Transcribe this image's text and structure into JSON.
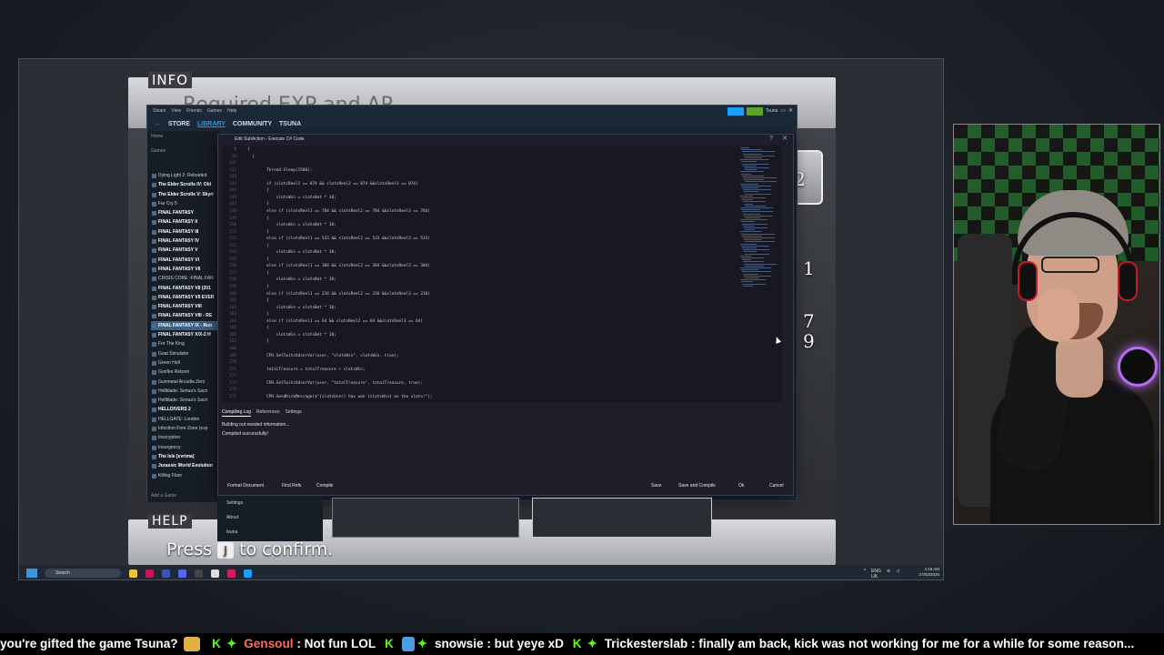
{
  "game": {
    "info_label": "INFO",
    "info_text": "Required EXP and AP",
    "help_label": "HELP",
    "help_prefix": "Press",
    "help_key": "J",
    "help_suffix": "to confirm.",
    "side_numbers": [
      "2",
      "1",
      "7",
      "9"
    ]
  },
  "steam": {
    "menu": [
      "Steam",
      "View",
      "Friends",
      "Games",
      "Help"
    ],
    "nav": [
      "STORE",
      "LIBRARY",
      "COMMUNITY",
      "TSUNA"
    ],
    "active_nav": "LIBRARY",
    "home": "Home",
    "games_label": "Games",
    "games": [
      "Dying Light 2: Reloaded",
      "The Elder Scrolls IV: Obl",
      "The Elder Scrolls V: Skyri",
      "Far Cry 5",
      "FINAL FANTASY",
      "FINAL FANTASY II",
      "FINAL FANTASY III",
      "FINAL FANTASY IV",
      "FINAL FANTASY V",
      "FINAL FANTASY VI",
      "FINAL FANTASY VII",
      "CRISIS CORE -FINAL FAN",
      "FINAL FANTASY VII (201",
      "FINAL FANTASY VII EVER",
      "FINAL FANTASY VIII",
      "FINAL FANTASY VIII - RE",
      "FINAL FANTASY IX - Run",
      "FINAL FANTASY X/X-2 H",
      "For The King",
      "Goat Simulator",
      "Green Hell",
      "Gunfire Reborn",
      "Gunmetal Arcadia Zero",
      "Hellblade: Senua's Sacri",
      "Hellblade: Senua's Sacri",
      "HELLDIVERS 2",
      "HELLGATE: London",
      "Infection Free Zone (exp",
      "Inscryption",
      "Insurgency",
      "The Isle [evrima]",
      "Jurassic World Evolution",
      "Killing Floor"
    ],
    "selected_game": "FINAL FANTASY IX - Run",
    "add_game": "Add a Game",
    "user": "Tsuna",
    "bottom_menu": [
      "Settings",
      "About",
      "tsuna"
    ]
  },
  "dialog": {
    "title": "Edit SubAction - Execute C# Code",
    "help_glyph": "?",
    "close_glyph": "✕",
    "code_lines": [
      {
        "n": "8",
        "t": "{"
      },
      {
        "n": "16",
        "t": "  {"
      },
      {
        "n": "141",
        "t": ""
      },
      {
        "n": "142",
        "t": "        Thread.Sleep(1500);"
      },
      {
        "n": "143",
        "t": ""
      },
      {
        "n": "144",
        "t": "        if (slotsReel1 == 874 && slotsReel2 == 874 &&slotsReel3 == 874)"
      },
      {
        "n": "145",
        "t": "        {"
      },
      {
        "n": "146",
        "t": "            slotsWin = slotsBet * 10;"
      },
      {
        "n": "147",
        "t": "        }"
      },
      {
        "n": "148",
        "t": "        else if (slotsReel1 == 784 && slotsReel2 == 784 &&slotsReel3 == 784)"
      },
      {
        "n": "149",
        "t": "        {"
      },
      {
        "n": "150",
        "t": "            slotsWin = slotsBet * 10;"
      },
      {
        "n": "151",
        "t": "        }"
      },
      {
        "n": "152",
        "t": "        else if (slotsReel1 == 533 && slotsReel2 == 533 &&slotsReel3 == 533)"
      },
      {
        "n": "153",
        "t": "        {"
      },
      {
        "n": "154",
        "t": "            slotsWin = slotsBet * 10;"
      },
      {
        "n": "155",
        "t": "        }"
      },
      {
        "n": "156",
        "t": "        else if (slotsReel1 == 384 && slotsReel2 == 384 &&slotsReel3 == 384)"
      },
      {
        "n": "157",
        "t": "        {"
      },
      {
        "n": "158",
        "t": "            slotsWin = slotsBet * 10;"
      },
      {
        "n": "159",
        "t": "        }"
      },
      {
        "n": "160",
        "t": "        else if (slotsReel1 == 216 && slotsReel2 == 216 &&slotsReel3 == 216)"
      },
      {
        "n": "161",
        "t": "        {"
      },
      {
        "n": "162",
        "t": "            slotsWin = slotsBet * 10;"
      },
      {
        "n": "163",
        "t": "        }"
      },
      {
        "n": "164",
        "t": "        else if (slotsReel1 == 64 && slotsReel2 == 64 &&slotsReel3 == 64)"
      },
      {
        "n": "165",
        "t": "        {"
      },
      {
        "n": "166",
        "t": "            slotsWin = slotsBet * 10;"
      },
      {
        "n": "167",
        "t": "        }"
      },
      {
        "n": "168",
        "t": ""
      },
      {
        "n": "169",
        "t": "        CPH.SetTwitchUserVar(user, \"slotsWin\", slotsWin, true);"
      },
      {
        "n": "170",
        "t": ""
      },
      {
        "n": "171",
        "t": "        totalTreasure = totalTreasure + slotsWin;"
      },
      {
        "n": "172",
        "t": ""
      },
      {
        "n": "173",
        "t": "        CPH.SetTwitchUserVar(user, \"totalTreasure\", totalTreasure, true);"
      },
      {
        "n": "174",
        "t": ""
      },
      {
        "n": "175",
        "t": "        CPH.SendKickMessage($\"{slotsUser} has won {slotsWin} on the slots!\");"
      }
    ],
    "tabs": [
      "Compiling Log",
      "References",
      "Settings"
    ],
    "active_tab": "Compiling Log",
    "log_lines": [
      "Building out needed information...",
      "Compiled successfully!"
    ],
    "buttons": {
      "format": "Format Document",
      "find_refs": "Find Refs",
      "compile": "Compile",
      "save": "Save",
      "save_compile": "Save and Compile",
      "ok": "Ok",
      "cancel": "Cancel"
    }
  },
  "taskbar": {
    "search": "Search",
    "lang1": "ENG",
    "lang2": "UK",
    "time": "4:19 AM",
    "date": "27/03/2026"
  },
  "chat": [
    {
      "user": "",
      "msg": "you're gifted the game Tsuna?"
    },
    {
      "user": "Gensoul",
      "user_color": "#ff6b5a",
      "msg": ": Not fun LOL"
    },
    {
      "user": "snowsie",
      "user_color": "#ffffff",
      "msg": ": but yeye xD"
    },
    {
      "user": "Trickesterslab",
      "user_color": "#ffffff",
      "msg": ": finally am back, kick was not working for me for a while for some reason..."
    }
  ],
  "colors": {
    "kick_green": "#53fc18",
    "steam_blue": "#1a9fff",
    "dialog_bg": "#1e1e2a"
  }
}
